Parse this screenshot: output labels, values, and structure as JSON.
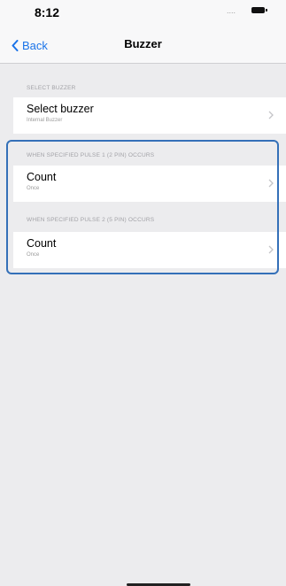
{
  "status_bar": {
    "time": "8:12",
    "signal": "....",
    "battery_icon": "battery-icon"
  },
  "nav": {
    "back_label": "Back",
    "back_icon": "chevron-left-icon",
    "title": "Buzzer"
  },
  "sections": [
    {
      "header": "SELECT BUZZER",
      "cell": {
        "title": "Select buzzer",
        "subtitle": "Internal Buzzer"
      }
    },
    {
      "header": "WHEN SPECIFIED PULSE 1 (2 PIN) OCCURS",
      "cell": {
        "title": "Count",
        "subtitle": "Once"
      }
    },
    {
      "header": "WHEN SPECIFIED PULSE 2 (5 PIN) OCCURS",
      "cell": {
        "title": "Count",
        "subtitle": "Once"
      }
    }
  ],
  "colors": {
    "accent": "#1a73e8",
    "highlight_border": "#3470b8",
    "background": "#ececee"
  }
}
